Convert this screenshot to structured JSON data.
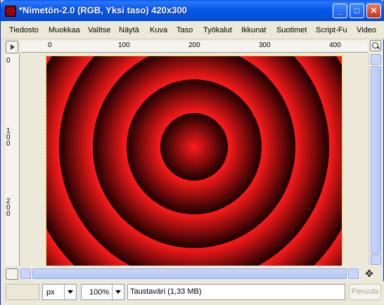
{
  "window": {
    "title": "*Nimetön-2.0 (RGB, Yksi taso) 420x300",
    "controls": {
      "minimize": "_",
      "maximize": "□",
      "close": "✕"
    }
  },
  "menu": {
    "items": [
      "Tiedosto",
      "Muokkaa",
      "Valitse",
      "Näytä",
      "Kuva",
      "Taso",
      "Työkalut",
      "Ikkunat",
      "Suotimet",
      "Script-Fu",
      "Video"
    ]
  },
  "rulers": {
    "horizontal_labels": [
      "0",
      "100",
      "200",
      "300",
      "400"
    ],
    "vertical_labels": [
      "0",
      "100",
      "200"
    ]
  },
  "canvas": {
    "width": 420,
    "height": 300,
    "colors": {
      "ring_light": "#FF1A1A",
      "ring_dark": "#1A0000",
      "selection": "#FFCC00"
    }
  },
  "statusbar": {
    "unit": "px",
    "zoom": "100%",
    "status_text": "Taustaväri (1,33 MB)",
    "cancel_label": "Peruuta"
  },
  "icons": {
    "navigate": "✥"
  }
}
